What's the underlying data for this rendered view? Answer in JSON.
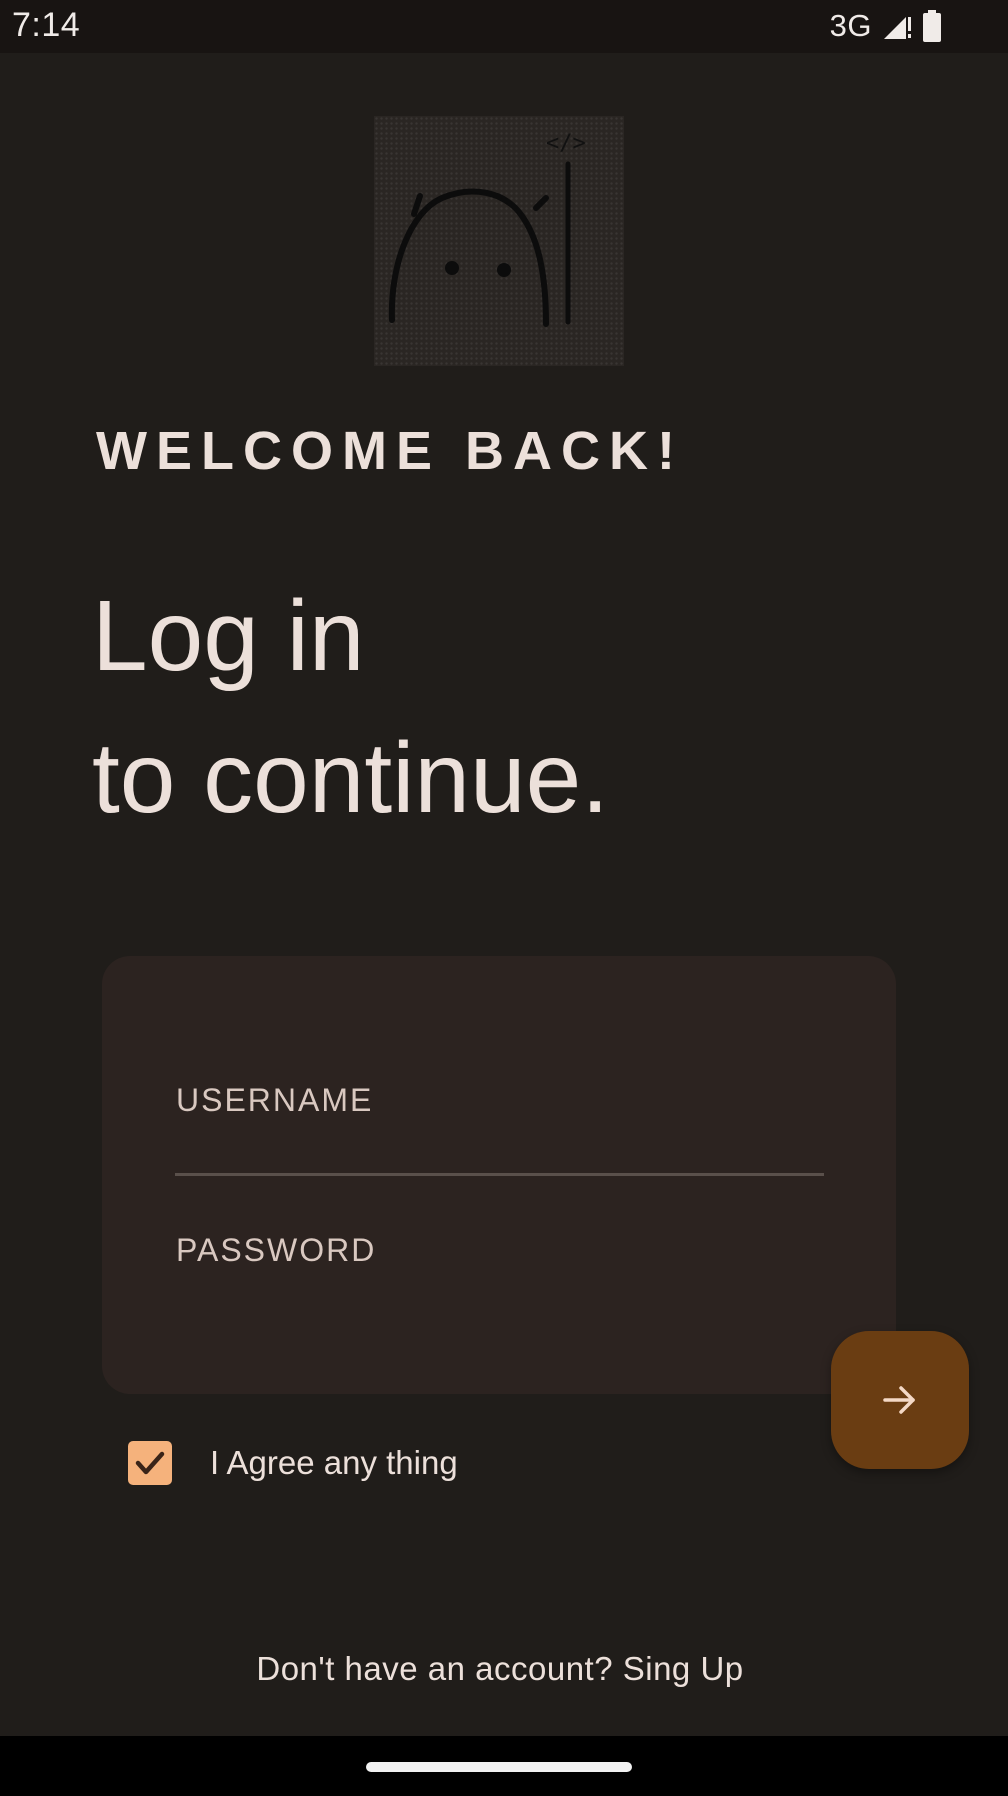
{
  "status_bar": {
    "time": "7:14",
    "network": "3G",
    "icons": [
      "signal-icon",
      "battery-icon"
    ]
  },
  "logo": {
    "icon": "code-mascot-logo",
    "tag": "</>"
  },
  "welcome_text": "WELCOME BACK!",
  "headline": {
    "line1": "Log in",
    "line2": "to continue."
  },
  "form": {
    "username_label": "USERNAME",
    "password_label": "PASSWORD",
    "submit_icon": "arrow-right-icon"
  },
  "agreement": {
    "label": "I Agree any thing",
    "checked": true
  },
  "signup": {
    "text": "Don't have an account? Sing Up"
  },
  "colors": {
    "background": "#201d1a",
    "card": "#2c2320",
    "accent": "#f5b27c",
    "fab": "#6a3d12",
    "text": "#ece0da"
  }
}
